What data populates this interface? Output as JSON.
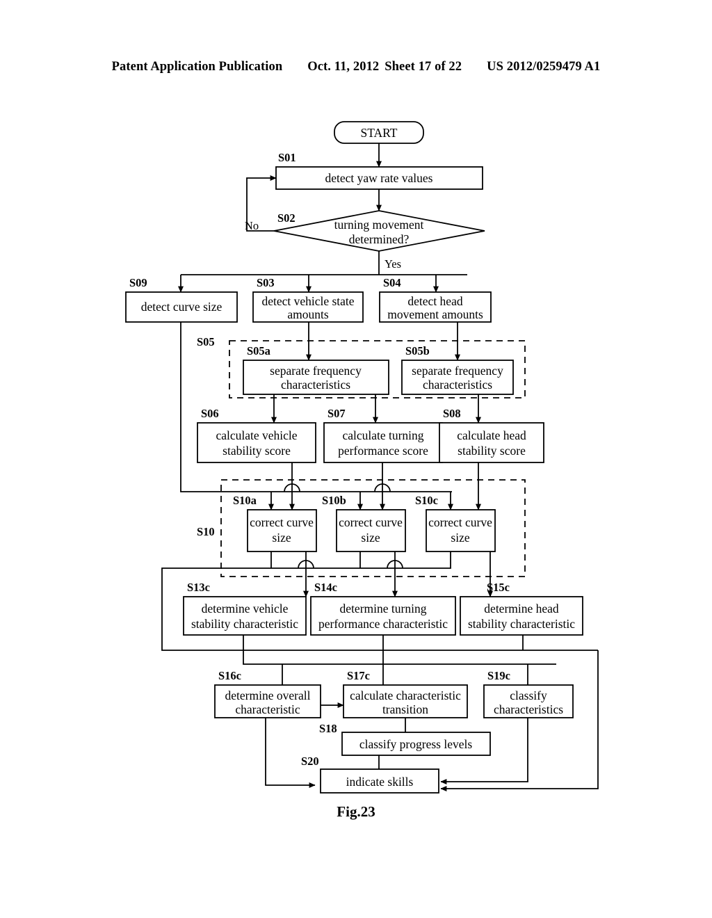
{
  "header": {
    "publication": "Patent Application Publication",
    "date": "Oct. 11, 2012",
    "sheet": "Sheet 17 of 22",
    "number": "US 2012/0259479 A1"
  },
  "figure": {
    "caption": "Fig.23"
  },
  "flowchart": {
    "start_label": "START",
    "branch_no": "No",
    "branch_yes": "Yes",
    "nodes": {
      "s01": {
        "tag": "S01",
        "text": "detect yaw rate values"
      },
      "s02": {
        "tag": "S02",
        "line1": "turning movement",
        "line2": "determined?"
      },
      "s09": {
        "tag": "S09",
        "text": "detect curve size"
      },
      "s03": {
        "tag": "S03",
        "line1": "detect vehicle state",
        "line2": "amounts"
      },
      "s04": {
        "tag": "S04",
        "line1": "detect head",
        "line2": "movement amounts"
      },
      "s05": {
        "tag": "S05"
      },
      "s05a": {
        "tag": "S05a",
        "line1": "separate frequency",
        "line2": "characteristics"
      },
      "s05b": {
        "tag": "S05b",
        "line1": "separate frequency",
        "line2": "characteristics"
      },
      "s06": {
        "tag": "S06",
        "line1": "calculate vehicle",
        "line2": "stability score"
      },
      "s07": {
        "tag": "S07",
        "line1": "calculate turning",
        "line2": "performance score"
      },
      "s08": {
        "tag": "S08",
        "line1": "calculate head",
        "line2": "stability score"
      },
      "s10": {
        "tag": "S10"
      },
      "s10a": {
        "tag": "S10a",
        "line1": "correct curve",
        "line2": "size"
      },
      "s10b": {
        "tag": "S10b",
        "line1": "correct curve",
        "line2": "size"
      },
      "s10c": {
        "tag": "S10c",
        "line1": "correct curve",
        "line2": "size"
      },
      "s13c": {
        "tag": "S13c",
        "line1": "determine vehicle",
        "line2": "stability characteristic"
      },
      "s14c": {
        "tag": "S14c",
        "line1": "determine turning",
        "line2": "performance characteristic"
      },
      "s15c": {
        "tag": "S15c",
        "line1": "determine head",
        "line2": "stability characteristic"
      },
      "s16c": {
        "tag": "S16c",
        "line1": "determine overall",
        "line2": "characteristic"
      },
      "s17c": {
        "tag": "S17c",
        "line1": "calculate characteristic",
        "line2": "transition"
      },
      "s19c": {
        "tag": "S19c",
        "line1": "classify",
        "line2": "characteristics"
      },
      "s18": {
        "tag": "S18",
        "text": "classify progress levels"
      },
      "s20": {
        "tag": "S20",
        "text": "indicate skills"
      }
    }
  }
}
